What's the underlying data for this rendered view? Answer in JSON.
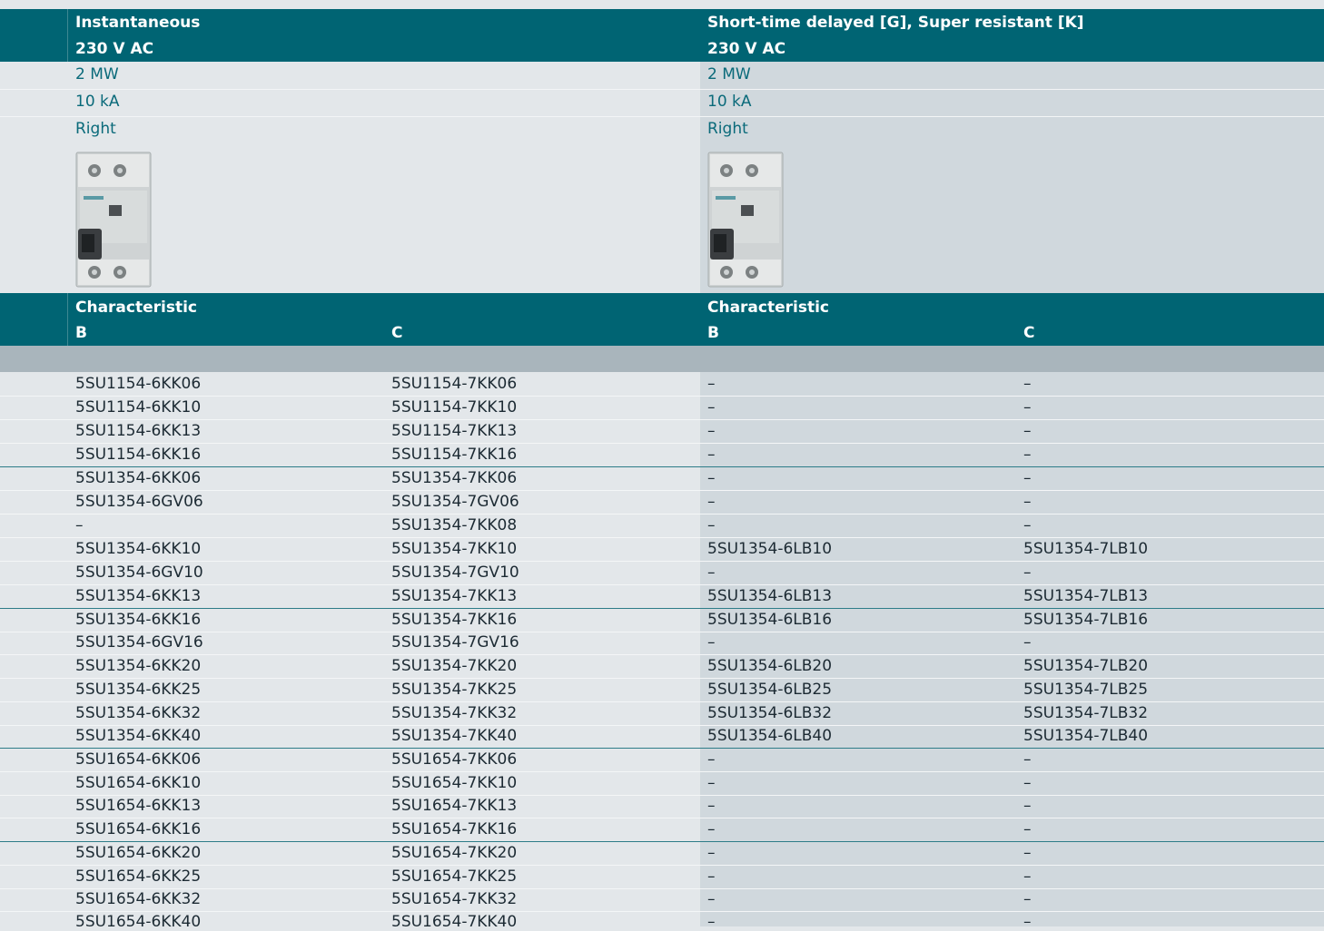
{
  "header": {
    "left": {
      "type": "Instantaneous",
      "voltage": "230 V AC"
    },
    "right": {
      "type": "Short-time delayed [G], Super resistant [K]",
      "voltage": "230 V AC"
    }
  },
  "specs": {
    "rating": {
      "left": "2 MW",
      "right": "2 MW"
    },
    "breaking_capacity": {
      "left": "10 kA",
      "right": "10 kA"
    },
    "orientation": {
      "left": "Right",
      "right": "Right"
    }
  },
  "characteristic_header": {
    "left_label": "Characteristic",
    "right_label": "Characteristic",
    "col_b": "B",
    "col_c": "C"
  },
  "rows": [
    [
      "5SU1154-6KK06",
      "5SU1154-7KK06",
      "–",
      "–"
    ],
    [
      "5SU1154-6KK10",
      "5SU1154-7KK10",
      "–",
      "–"
    ],
    [
      "5SU1154-6KK13",
      "5SU1154-7KK13",
      "–",
      "–"
    ],
    [
      "5SU1154-6KK16",
      "5SU1154-7KK16",
      "–",
      "–"
    ],
    [
      "5SU1354-6KK06",
      "5SU1354-7KK06",
      "–",
      "–"
    ],
    [
      "5SU1354-6GV06",
      "5SU1354-7GV06",
      "–",
      "–"
    ],
    [
      "–",
      "5SU1354-7KK08",
      "–",
      "–"
    ],
    [
      "5SU1354-6KK10",
      "5SU1354-7KK10",
      "5SU1354-6LB10",
      "5SU1354-7LB10"
    ],
    [
      "5SU1354-6GV10",
      "5SU1354-7GV10",
      "–",
      "–"
    ],
    [
      "5SU1354-6KK13",
      "5SU1354-7KK13",
      "5SU1354-6LB13",
      "5SU1354-7LB13"
    ],
    [
      "5SU1354-6KK16",
      "5SU1354-7KK16",
      "5SU1354-6LB16",
      "5SU1354-7LB16"
    ],
    [
      "5SU1354-6GV16",
      "5SU1354-7GV16",
      "–",
      "–"
    ],
    [
      "5SU1354-6KK20",
      "5SU1354-7KK20",
      "5SU1354-6LB20",
      "5SU1354-7LB20"
    ],
    [
      "5SU1354-6KK25",
      "5SU1354-7KK25",
      "5SU1354-6LB25",
      "5SU1354-7LB25"
    ],
    [
      "5SU1354-6KK32",
      "5SU1354-7KK32",
      "5SU1354-6LB32",
      "5SU1354-7LB32"
    ],
    [
      "5SU1354-6KK40",
      "5SU1354-7KK40",
      "5SU1354-6LB40",
      "5SU1354-7LB40"
    ],
    [
      "5SU1654-6KK06",
      "5SU1654-7KK06",
      "–",
      "–"
    ],
    [
      "5SU1654-6KK10",
      "5SU1654-7KK10",
      "–",
      "–"
    ],
    [
      "5SU1654-6KK13",
      "5SU1654-7KK13",
      "–",
      "–"
    ],
    [
      "5SU1654-6KK16",
      "5SU1654-7KK16",
      "–",
      "–"
    ],
    [
      "5SU1654-6KK20",
      "5SU1654-7KK20",
      "–",
      "–"
    ],
    [
      "5SU1654-6KK25",
      "5SU1654-7KK25",
      "–",
      "–"
    ],
    [
      "5SU1654-6KK32",
      "5SU1654-7KK32",
      "–",
      "–"
    ],
    [
      "5SU1654-6KK40",
      "5SU1654-7KK40",
      "–",
      "–"
    ]
  ]
}
